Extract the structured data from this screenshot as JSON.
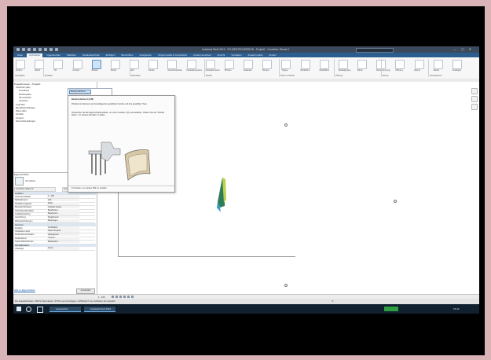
{
  "app": {
    "title": "Autodesk Revit 2019 - STUDENTENVERSION - Projekt1 - Grundriss: Ebene 0",
    "search_placeholder": "Suchbegriff oder Frage eingeben",
    "window_controls": [
      "—",
      "▢",
      "✕"
    ]
  },
  "tabs": [
    "Datei",
    "Architektur",
    "Ingenieurbau",
    "Stahlbau",
    "Gebäudetechnik",
    "Einfügen",
    "Beschriften",
    "Analysieren",
    "Körpermodell & Grundstück",
    "Zusammenarbeit",
    "Ansicht",
    "Verwalten",
    "Zusatzmodule",
    "Ändern"
  ],
  "active_tab_index": 1,
  "ribbon": {
    "buttons": [
      "Ändern",
      "Wand",
      "Tür",
      "Fenster",
      "Bauteil",
      "Stütze",
      "Dach",
      "Decke",
      "Geschossdecke",
      "Fassadensystem",
      "Fassadenraster",
      "Pfosten",
      "Geländer",
      "Rampe",
      "Treppe",
      "Modelltext",
      "Modelllinie",
      "Modellgruppe",
      "Raum",
      "Raumtrennung",
      "Öffnung",
      "Ebene",
      "Raster",
      "Festlegen"
    ],
    "panels": [
      "Auswählen",
      "Erstellen",
      "Zirkulation",
      "Modell",
      "Raum & Fläche",
      "Öffnung",
      "Bezug",
      "Arbeitsebene"
    ]
  },
  "flyout": {
    "items": [
      "Bauteil platzieren",
      "Projektbauteil erstellen"
    ]
  },
  "tooltip": {
    "title": "Bauteil platzieren (CM)",
    "body1": "Platziert ein Element auf Grundlage der gewählten Familie und des gewählten Typs.",
    "body2": "Verwenden Sie die Eigenschaftenpalette, um einen anderen Typ auszuwählen. Klicken Sie auf \"Familie laden\", um weitere Familien zu laden.",
    "footer": "F1 drücken, um weitere Hilfe zu erhalten"
  },
  "browser": {
    "title": "Projektbrowser - Projekt1",
    "items": [
      "Ansichten (alle)",
      "Grundrisse",
      "Deckenpläne",
      "3D-Ansichten",
      "Ansichten",
      "Legenden",
      "Bauteillisten/Mengen",
      "Pläne (alle)",
      "Familien",
      "Gruppen",
      "Revit-Verknüpfungen"
    ]
  },
  "properties": {
    "title": "Eigenschaften",
    "type_name": "Grundriss",
    "edit_type": "Typ bearbeiten",
    "selector": "Grundriss: Ebene 0",
    "groups": [
      "Grafiken",
      "Grenzen",
      "Identitätsdaten"
    ],
    "rows": [
      {
        "label": "Ansichtsmaßstab",
        "value": "1 : 100"
      },
      {
        "label": "Maßstabswert",
        "value": "100"
      },
      {
        "label": "Detaillierungsgrad",
        "value": "Mittel"
      },
      {
        "label": "Bauteilsichtbarkeit",
        "value": "Original zeigen"
      },
      {
        "label": "Sichtbarkeit/Grafiken",
        "value": "Bearbeiten..."
      },
      {
        "label": "Grafikdarstellung",
        "value": "Bearbeiten..."
      },
      {
        "label": "Ausrichtung",
        "value": "Projektnord"
      },
      {
        "label": "Wandverbindungen",
        "value": "Bereinigen"
      },
      {
        "label": "Disziplin",
        "value": "Architektur"
      },
      {
        "label": "Verdeckte Linien",
        "value": "Nach Disziplin"
      },
      {
        "label": "Farbschema-Position",
        "value": "Hintergrund"
      },
      {
        "label": "Farbschema",
        "value": "<Keine>"
      },
      {
        "label": "Systemfarbschemas",
        "value": "Bearbeiten..."
      },
      {
        "label": "Unterlage",
        "value": "Keine"
      }
    ],
    "help_link": "Hilfe zu Eigenschaften",
    "apply_button": "Anwenden"
  },
  "status": {
    "scale": "1 : 100",
    "message": "Zur Auswahl klicken, TAB für Alternativen, STRG zum Hinzufügen, UMSCHALT zum Aufheben der Auswahl.",
    "level": ":0"
  },
  "taskbar": {
    "items": [
      "Lesezeichen",
      "Autodesk Revit 2019 ..."
    ],
    "time": "15:42"
  },
  "colors": {
    "title_bar": "#3a4a5c",
    "tab_bar": "#2c5d8f",
    "taskbar": "#10202e",
    "frame": "#d9b3b6",
    "shape_dark": "#2e7d5a",
    "shape_light": "#b9d34a",
    "shape_accent": "#2f9ad0"
  }
}
